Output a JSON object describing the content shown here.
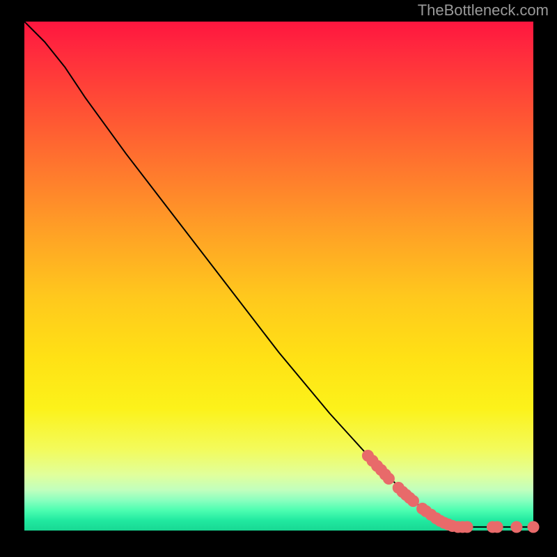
{
  "attribution": "TheBottleneck.com",
  "chart_data": {
    "type": "line",
    "title": "",
    "xlabel": "",
    "ylabel": "",
    "xlim": [
      0,
      100
    ],
    "ylim": [
      0,
      100
    ],
    "series": [
      {
        "name": "curve",
        "points": [
          {
            "x": 0.0,
            "y": 100.0
          },
          {
            "x": 4.0,
            "y": 96.0
          },
          {
            "x": 8.0,
            "y": 91.0
          },
          {
            "x": 12.0,
            "y": 85.0
          },
          {
            "x": 20.0,
            "y": 74.0
          },
          {
            "x": 30.0,
            "y": 61.0
          },
          {
            "x": 40.0,
            "y": 48.0
          },
          {
            "x": 50.0,
            "y": 35.0
          },
          {
            "x": 60.0,
            "y": 23.0
          },
          {
            "x": 70.0,
            "y": 12.0
          },
          {
            "x": 78.0,
            "y": 4.5
          },
          {
            "x": 82.0,
            "y": 1.6
          },
          {
            "x": 85.0,
            "y": 0.7
          },
          {
            "x": 90.0,
            "y": 0.7
          },
          {
            "x": 95.0,
            "y": 0.7
          },
          {
            "x": 100.0,
            "y": 0.7
          }
        ]
      }
    ],
    "scatter": {
      "name": "marked-points",
      "color": "#e86a6a",
      "radius": 1.1,
      "points": [
        {
          "x": 67.5,
          "y": 14.7
        },
        {
          "x": 68.4,
          "y": 13.7
        },
        {
          "x": 69.3,
          "y": 12.7
        },
        {
          "x": 70.1,
          "y": 11.9
        },
        {
          "x": 70.9,
          "y": 11.0
        },
        {
          "x": 71.6,
          "y": 10.2
        },
        {
          "x": 73.5,
          "y": 8.4
        },
        {
          "x": 74.3,
          "y": 7.6
        },
        {
          "x": 75.0,
          "y": 7.0
        },
        {
          "x": 75.7,
          "y": 6.4
        },
        {
          "x": 76.4,
          "y": 5.8
        },
        {
          "x": 78.2,
          "y": 4.3
        },
        {
          "x": 78.9,
          "y": 3.8
        },
        {
          "x": 79.9,
          "y": 3.1
        },
        {
          "x": 80.9,
          "y": 2.4
        },
        {
          "x": 81.7,
          "y": 1.9
        },
        {
          "x": 82.5,
          "y": 1.5
        },
        {
          "x": 83.3,
          "y": 1.2
        },
        {
          "x": 84.1,
          "y": 0.9
        },
        {
          "x": 85.2,
          "y": 0.7
        },
        {
          "x": 86.1,
          "y": 0.7
        },
        {
          "x": 87.0,
          "y": 0.7
        },
        {
          "x": 92.0,
          "y": 0.7
        },
        {
          "x": 92.9,
          "y": 0.7
        },
        {
          "x": 96.7,
          "y": 0.7
        },
        {
          "x": 100.0,
          "y": 0.7
        }
      ]
    }
  }
}
